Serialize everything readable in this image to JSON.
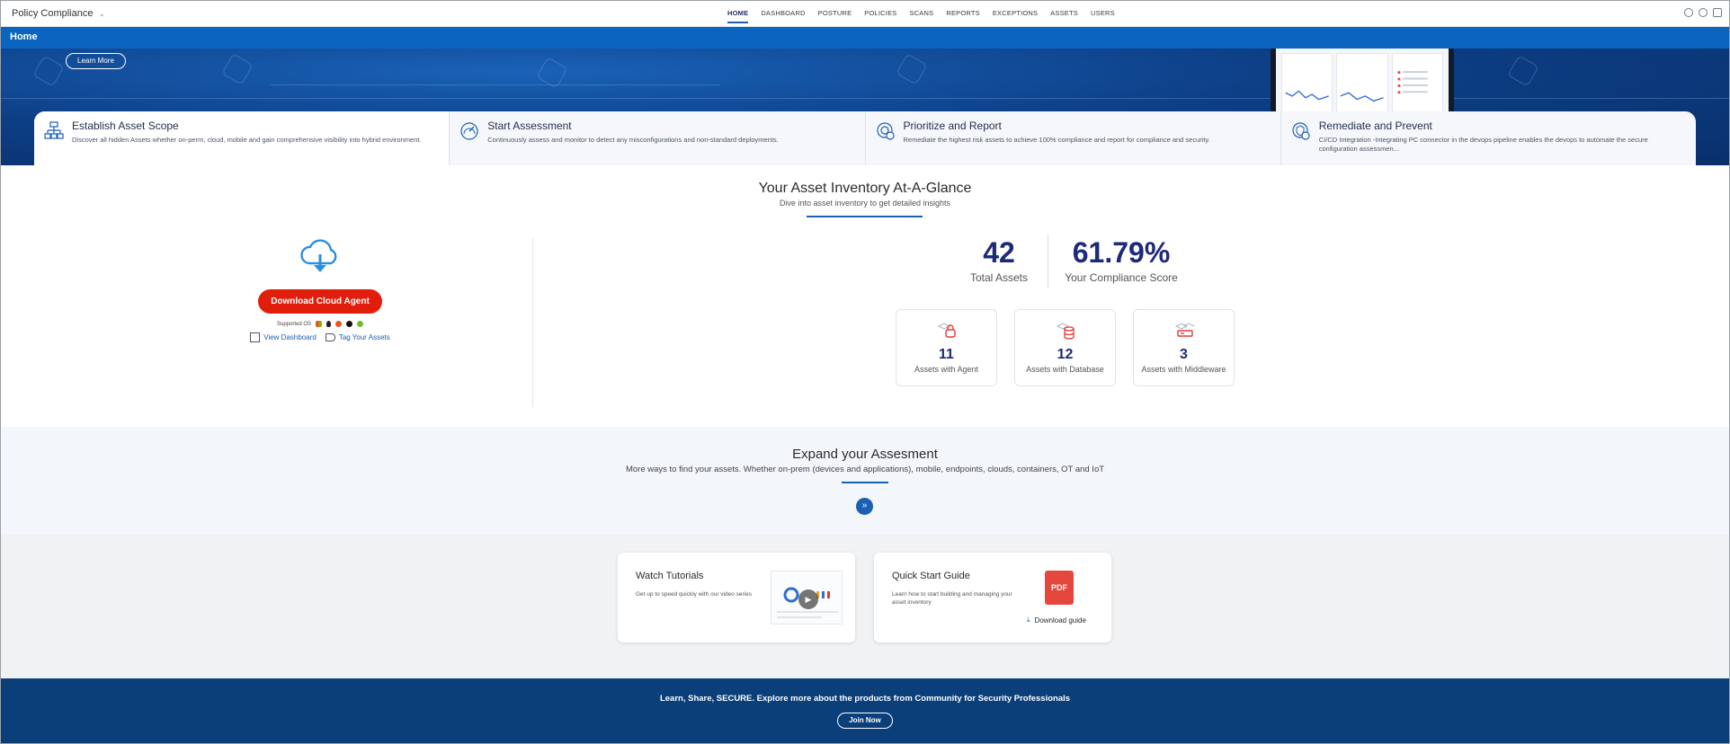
{
  "app": {
    "name": "Policy Compliance"
  },
  "nav": {
    "items": [
      "HOME",
      "DASHBOARD",
      "POSTURE",
      "POLICIES",
      "SCANS",
      "REPORTS",
      "EXCEPTIONS",
      "ASSETS",
      "USERS"
    ],
    "active": "HOME"
  },
  "titlebar": {
    "title": "Home"
  },
  "hero": {
    "learn_more": "Learn More"
  },
  "steps": [
    {
      "title": "Establish Asset Scope",
      "desc": "Discover all hidden Assets whether on-perm, cloud, mobile and gain comprehensive visibility into hybrid environment.",
      "icon": "network-icon"
    },
    {
      "title": "Start Assessment",
      "desc": "Continuously assess and monitor to detect any misconfigurations and non-standard deployments.",
      "icon": "gauge-icon"
    },
    {
      "title": "Prioritize and Report",
      "desc": "Remediate the highest risk assets to achieve 100% compliance and report for compliance and security.",
      "icon": "target-gear-icon"
    },
    {
      "title": "Remediate and Prevent",
      "desc": "CI/CD Integration -Integrating PC connector in the devops pipeline enables the devops to automate the secure configuration assessmen...",
      "icon": "shield-gear-icon"
    }
  ],
  "glance": {
    "title": "Your Asset Inventory At-A-Glance",
    "subtitle": "Dive into asset inventory to get detailed insights",
    "download_button": "Download Cloud Agent",
    "supported_os": "Supported OS",
    "view_dashboard": "View Dashboard",
    "tag_assets": "Tag Your Assets",
    "total_assets": {
      "value": "42",
      "label": "Total Assets"
    },
    "compliance_score": {
      "value": "61.79%",
      "label": "Your Compliance Score"
    },
    "mini": [
      {
        "value": "11",
        "label": "Assets with Agent"
      },
      {
        "value": "12",
        "label": "Assets with Database"
      },
      {
        "value": "3",
        "label": "Assets with Middleware"
      }
    ]
  },
  "expand": {
    "title": "Expand your Assesment",
    "subtitle": "More ways to find your assets. Whether on-prem (devices and applications), mobile, endpoints, clouds, containers, OT and IoT"
  },
  "resources": {
    "tutorials": {
      "title": "Watch Tutorials",
      "desc": "Get up to speed quickly with our video series"
    },
    "guide": {
      "title": "Quick Start Guide",
      "desc": "Learn how to start building and managing your asset inventory",
      "pdf": "PDF",
      "download": "Download guide"
    }
  },
  "footer": {
    "text": "Learn, Share, SECURE. Explore more about the products from Community for Security Professionals",
    "join": "Join Now"
  },
  "colors": {
    "primary": "#0b64c0",
    "accent": "#e11d0b",
    "navy": "#1d2a78"
  }
}
